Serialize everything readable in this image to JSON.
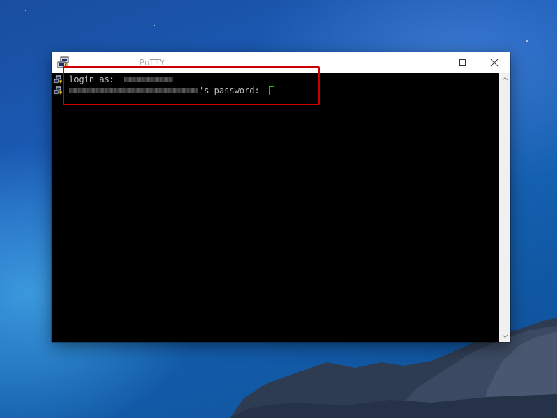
{
  "window": {
    "title": "- PuTTY",
    "app_icon": "putty-icon",
    "controls": {
      "minimize": "minimize-icon",
      "maximize": "maximize-icon",
      "close": "close-icon"
    }
  },
  "terminal": {
    "background": "#000000",
    "text_color": "#c0c0c0",
    "cursor_color": "#00d000",
    "lines": [
      {
        "prompt": "login as:",
        "value_redacted": true
      },
      {
        "prefix_redacted": true,
        "prompt": "'s password:",
        "cursor": true
      }
    ]
  },
  "scrollbar": {
    "up_icon": "chevron-up-icon",
    "down_icon": "chevron-down-icon"
  },
  "annotation": {
    "color": "#cc0000"
  }
}
